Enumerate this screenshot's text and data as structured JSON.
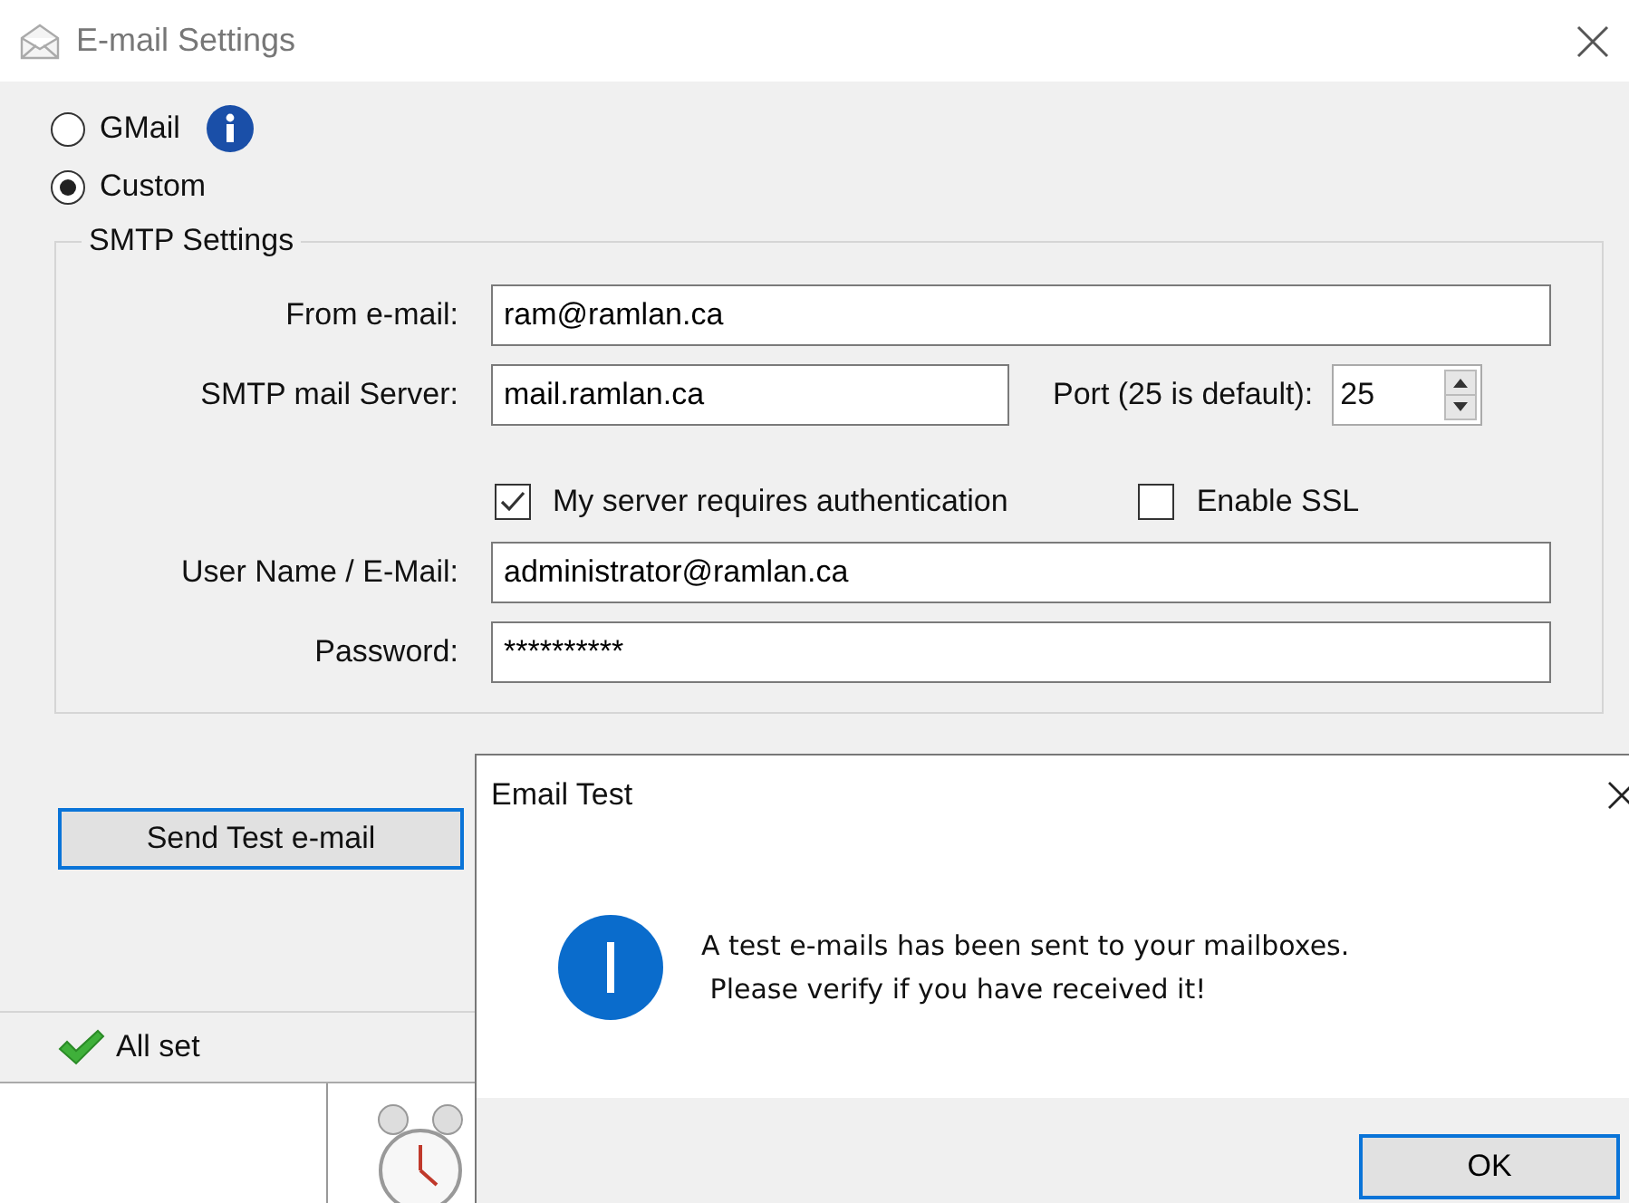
{
  "window": {
    "title": "E-mail Settings"
  },
  "providers": [
    {
      "label": "GMail",
      "selected": false,
      "has_info": true
    },
    {
      "label": "Custom",
      "selected": true,
      "has_info": false
    }
  ],
  "smtp": {
    "title": "SMTP Settings",
    "from_label": "From e-mail:",
    "from_value": "ram@ramlan.ca",
    "server_label": "SMTP mail Server:",
    "server_value": "mail.ramlan.ca",
    "port_label": "Port (25 is default):",
    "port_value": "25",
    "auth": {
      "label": "My server requires authentication",
      "checked": true
    },
    "ssl": {
      "label": "Enable SSL",
      "checked": false
    },
    "user_label": "User Name / E-Mail:",
    "user_value": "administrator@ramlan.ca",
    "password_label": "Password:",
    "password_value": "**********"
  },
  "send_button": "Send Test e-mail",
  "status": {
    "text": "All set",
    "ok": true
  },
  "dialog": {
    "title": "Email Test",
    "message_lines": [
      "A test e-mails has been sent to your mailboxes.",
      " Please verify if you have received it!"
    ],
    "button": "OK"
  }
}
